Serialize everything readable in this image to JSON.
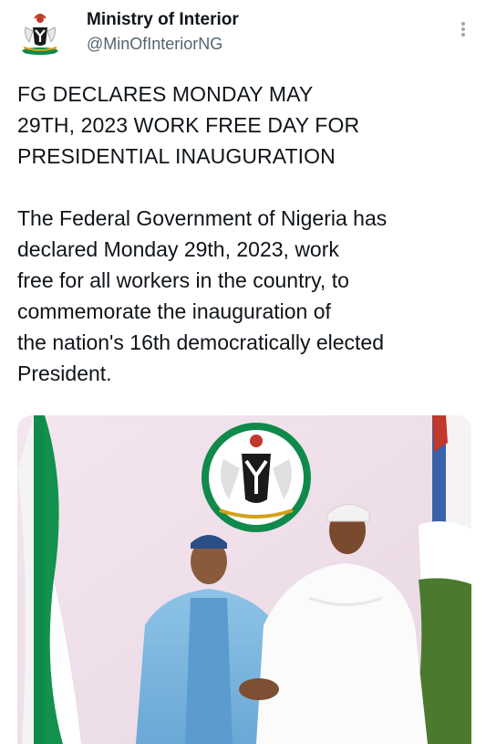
{
  "author": {
    "display_name": "Ministry of Interior",
    "handle": "@MinOfInteriorNG",
    "avatar_icon": "coat-of-arms-icon"
  },
  "tweet": {
    "headline": "FG DECLARES MONDAY MAY\n29TH, 2023 WORK FREE DAY FOR\nPRESIDENTIAL INAUGURATION",
    "body": "The Federal Government of Nigeria has\ndeclared Monday 29th, 2023, work\nfree for all workers in the country, to\ncommemorate the inauguration of\nthe nation's 16th democratically elected\nPresident."
  },
  "menu": {
    "icon": "more-options-icon"
  },
  "colors": {
    "green": "#0f8a4a",
    "handle_grey": "#536471",
    "text": "#0f1419"
  }
}
